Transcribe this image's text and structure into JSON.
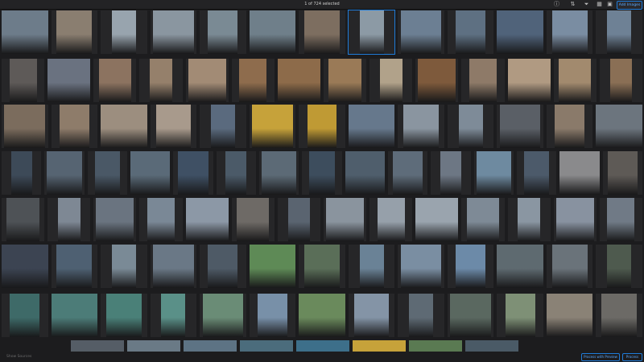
{
  "status_text": "1 of 724 selected",
  "toolbar": {
    "add_images_label": "Add Images",
    "icons": [
      "info-icon",
      "sort-icon",
      "filter-icon",
      "grid-view-icon",
      "layout-icon"
    ],
    "icon_glyphs": [
      "ⓘ",
      "⇅",
      "⏷",
      "▦",
      "▣"
    ]
  },
  "footer": {
    "left_label": "Show Sources",
    "preview_label": "Process with Preview",
    "done_label": "Process"
  },
  "grid": {
    "selected_index": 7,
    "accent": "#1f7bd8",
    "rows": [
      [
        "#6d7c8a",
        "#8a7e70",
        "#98a4ae",
        "#8a96a0",
        "#7a8a94",
        "#6f7f8a",
        "#7d6e60",
        "#8c9aa5",
        "#6c7f93",
        "#5e7082",
        "#50637a",
        "#7a8da2",
        "#6e8195"
      ],
      [
        "#5e5a58",
        "#6a7280",
        "#8c7360",
        "#95806b",
        "#a28b75",
        "#8e6c4d",
        "#8d6b4a",
        "#9a7a57",
        "#b1a28a",
        "#7e5a3c",
        "#8e7a68",
        "#b09a82",
        "#a28a6e",
        "#8a6f55"
      ],
      [
        "#7b6c5d",
        "#8e7c6a",
        "#9c8e7f",
        "#a89a8c",
        "#5a6a7e",
        "#c6a23a",
        "#bf9a34",
        "#66788c",
        "#8a95a0",
        "#7e8b98",
        "#5a5f66",
        "#8a7a6a",
        "#6c757e"
      ],
      [
        "#3d4a58",
        "#566472",
        "#4a5866",
        "#5a6a78",
        "#3f5064",
        "#4b5a68",
        "#5c6a76",
        "#3d4d5d",
        "#4f5e6c",
        "#5e6c7a",
        "#6d7784",
        "#6e8aa0",
        "#4c5a6a",
        "#8a8a8c",
        "#5e5a56"
      ],
      [
        "#4e5256",
        "#7e8894",
        "#6a7480",
        "#7a8896",
        "#8c98a6",
        "#6e6a66",
        "#5a6470",
        "#8a949e",
        "#96a0aa",
        "#9aa4ae",
        "#7e8a96",
        "#8a96a2",
        "#8892a0",
        "#707a86"
      ],
      [
        "#3c4452",
        "#4e6072",
        "#7a8a96",
        "#6a7886",
        "#4e5a66",
        "#5e8a56",
        "#5a6e58",
        "#6a8296",
        "#7a8ea2",
        "#6c8aa8",
        "#5e6a70",
        "#6a737a",
        "#4e5a4e"
      ],
      [
        "#3e6a68",
        "#4c7c78",
        "#4a8078",
        "#5a9088",
        "#6a8c76",
        "#7890a8",
        "#6a8a5c",
        "#8494a6",
        "#5e6a74",
        "#5a6860",
        "#7e9076",
        "#8a8276",
        "#6c6a66"
      ]
    ],
    "extra_row": [
      "#555d66",
      "#6a7a86",
      "#5d7384",
      "#4b6c7c",
      "#3d6f8a",
      "#c6a23a",
      "#5a7a52",
      "#4a5a66"
    ]
  }
}
